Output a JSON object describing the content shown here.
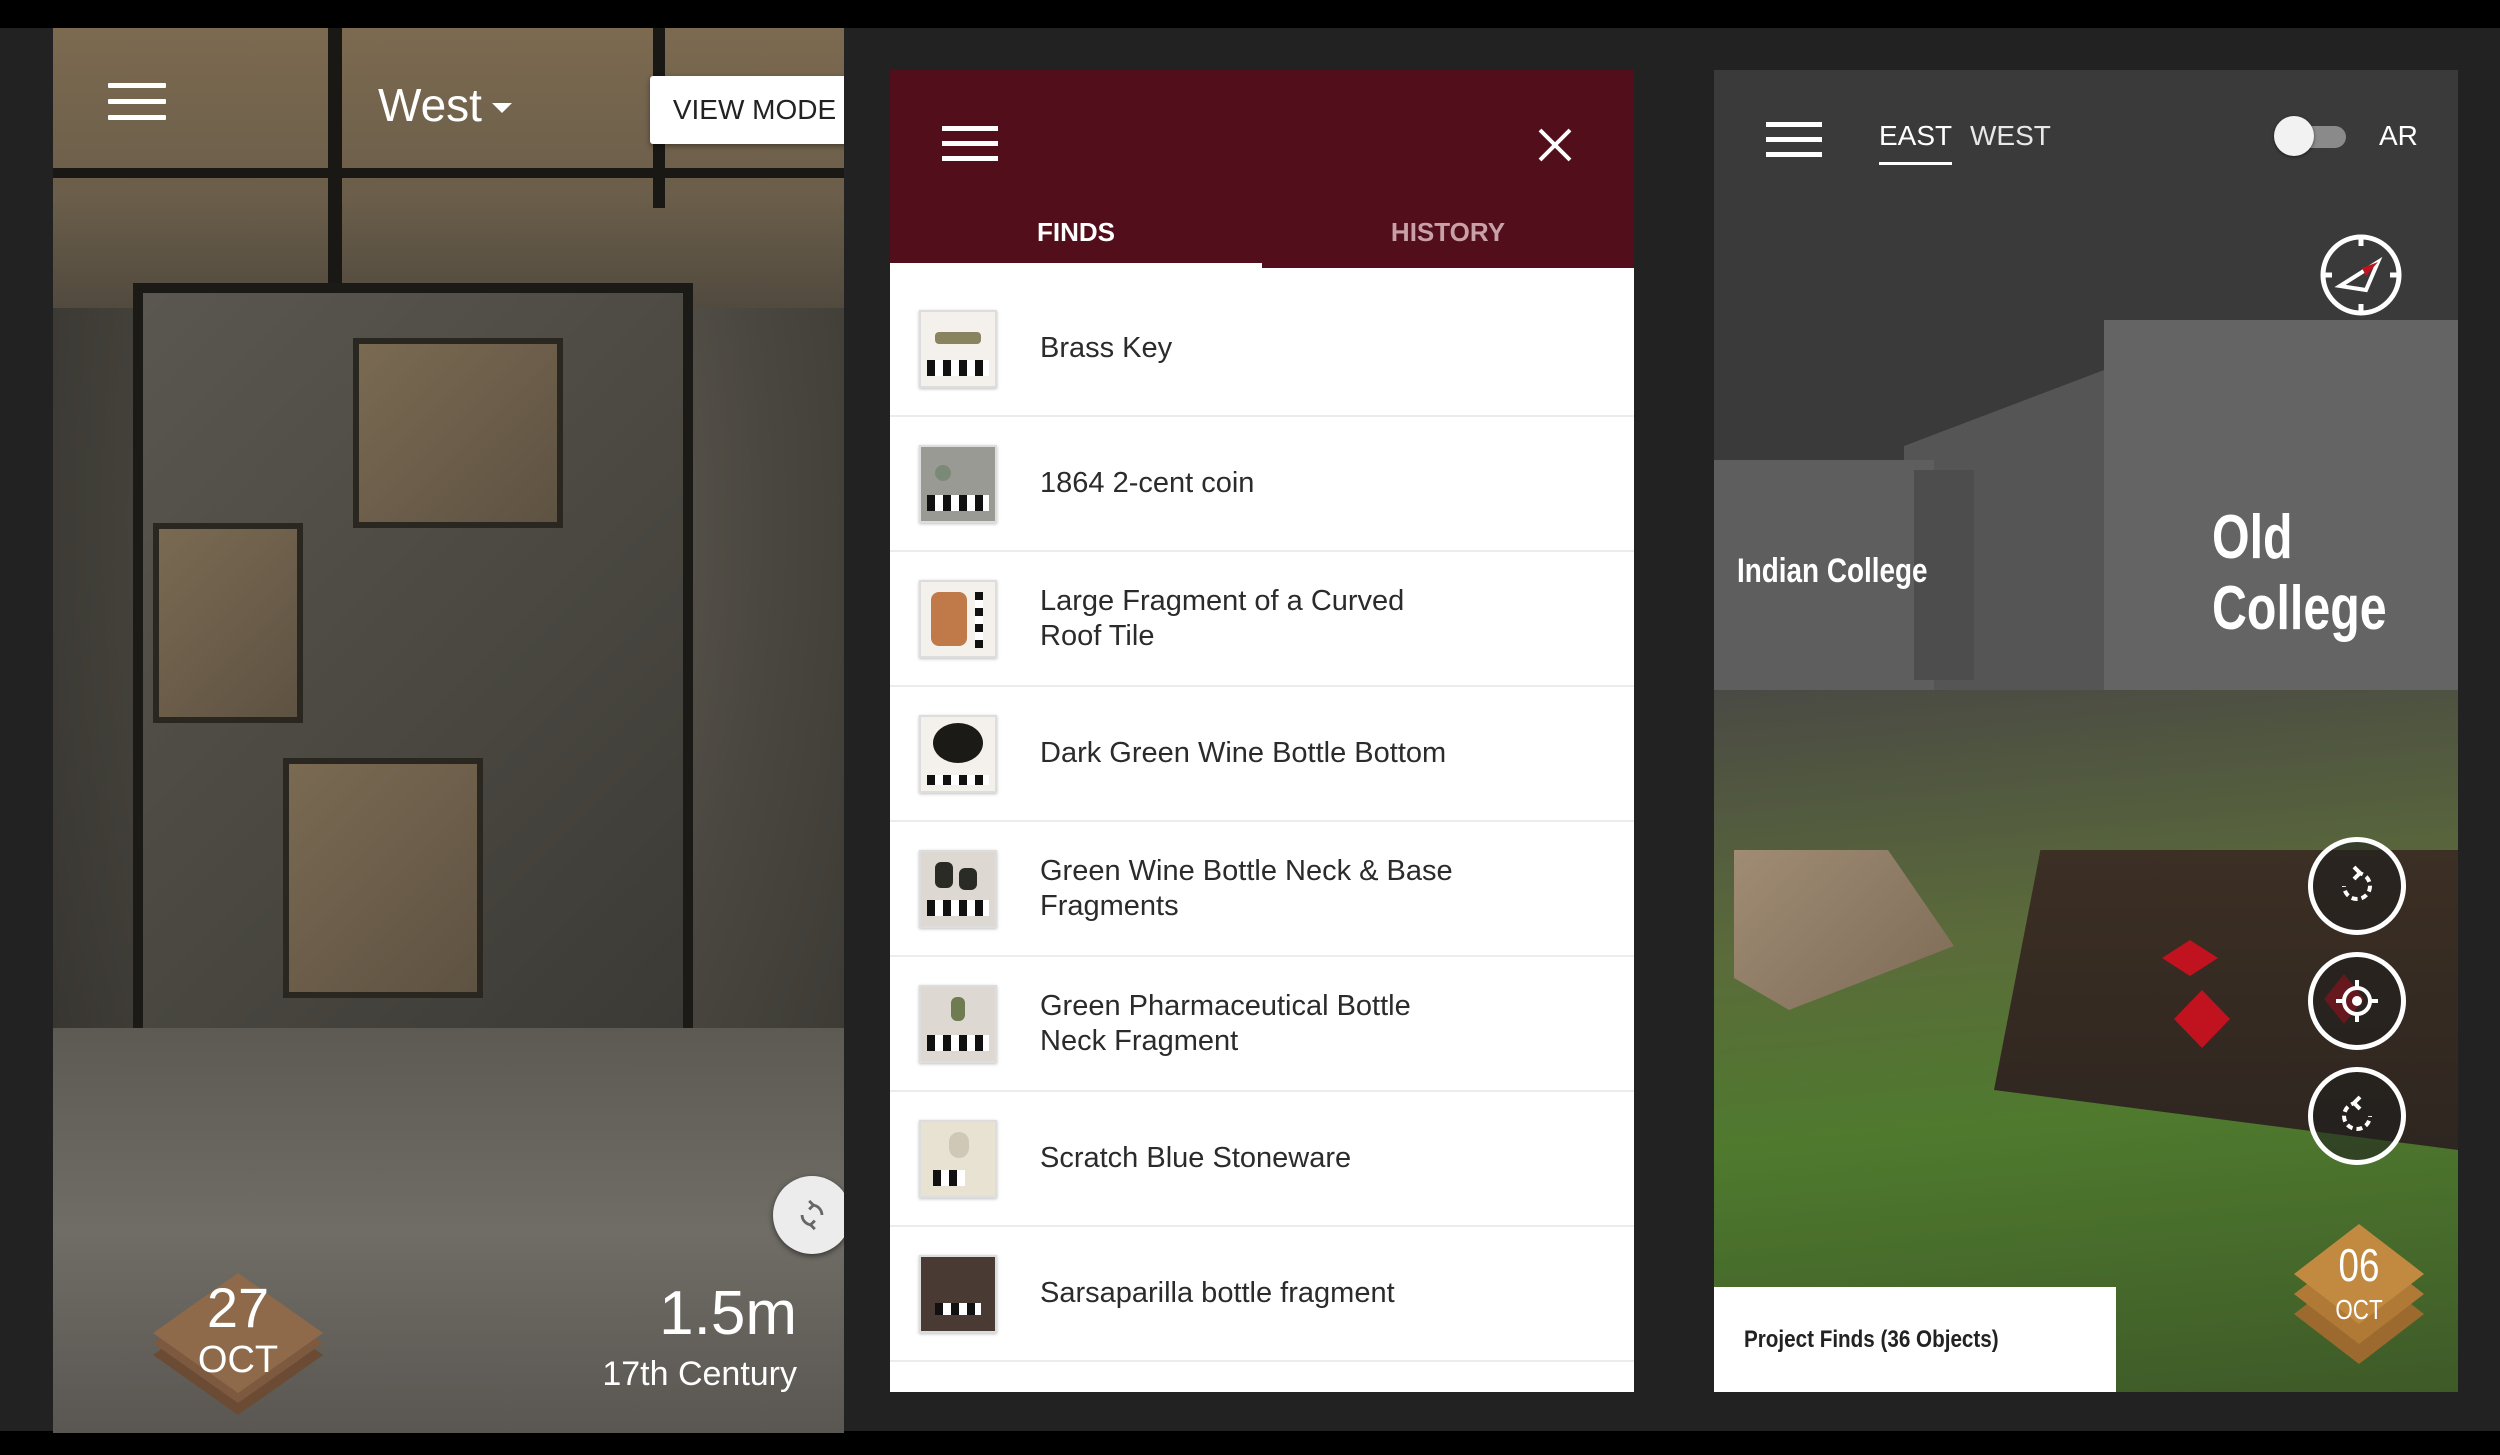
{
  "screen1": {
    "location": "West",
    "view_mode_label": "VIEW MODE",
    "date_day": "27",
    "date_month": "OCT",
    "depth": "1.5m",
    "era": "17th Century"
  },
  "screen2": {
    "tabs": [
      {
        "label": "FINDS",
        "active": true
      },
      {
        "label": "HISTORY",
        "active": false
      }
    ],
    "finds": [
      {
        "label": "Brass Key",
        "icon": "brass-key-thumb",
        "color": "#8a8360"
      },
      {
        "label": "1864 2-cent coin",
        "icon": "coin-thumb",
        "color": "#8e8e86"
      },
      {
        "label": "Large Fragment of a Curved Roof Tile",
        "icon": "roof-tile-thumb",
        "color": "#c07a4a"
      },
      {
        "label": "Dark Green Wine Bottle Bottom",
        "icon": "wine-bottle-bottom-thumb",
        "color": "#1c1a16"
      },
      {
        "label": "Green Wine Bottle Neck & Base Fragments",
        "icon": "bottle-neck-thumb",
        "color": "#2b2b26"
      },
      {
        "label": "Green Pharmaceutical Bottle Neck Fragment",
        "icon": "pharma-bottle-thumb",
        "color": "#6f7c52"
      },
      {
        "label": "Scratch Blue Stoneware",
        "icon": "stoneware-thumb",
        "color": "#cfc8b6"
      },
      {
        "label": "Sarsaparilla bottle fragment",
        "icon": "sarsaparilla-thumb",
        "color": "#4a3a34"
      }
    ]
  },
  "screen3": {
    "tab_east": "EAST",
    "tab_west": "WEST",
    "ar_label": "AR",
    "ar_enabled": false,
    "building_left": "Indian College",
    "building_right": "Old College",
    "finds_panel": "Project Finds (36 Objects)",
    "date_day": "06",
    "date_month": "OCT",
    "colors": {
      "marker": "#c1121f",
      "header": "#520f1b"
    }
  }
}
